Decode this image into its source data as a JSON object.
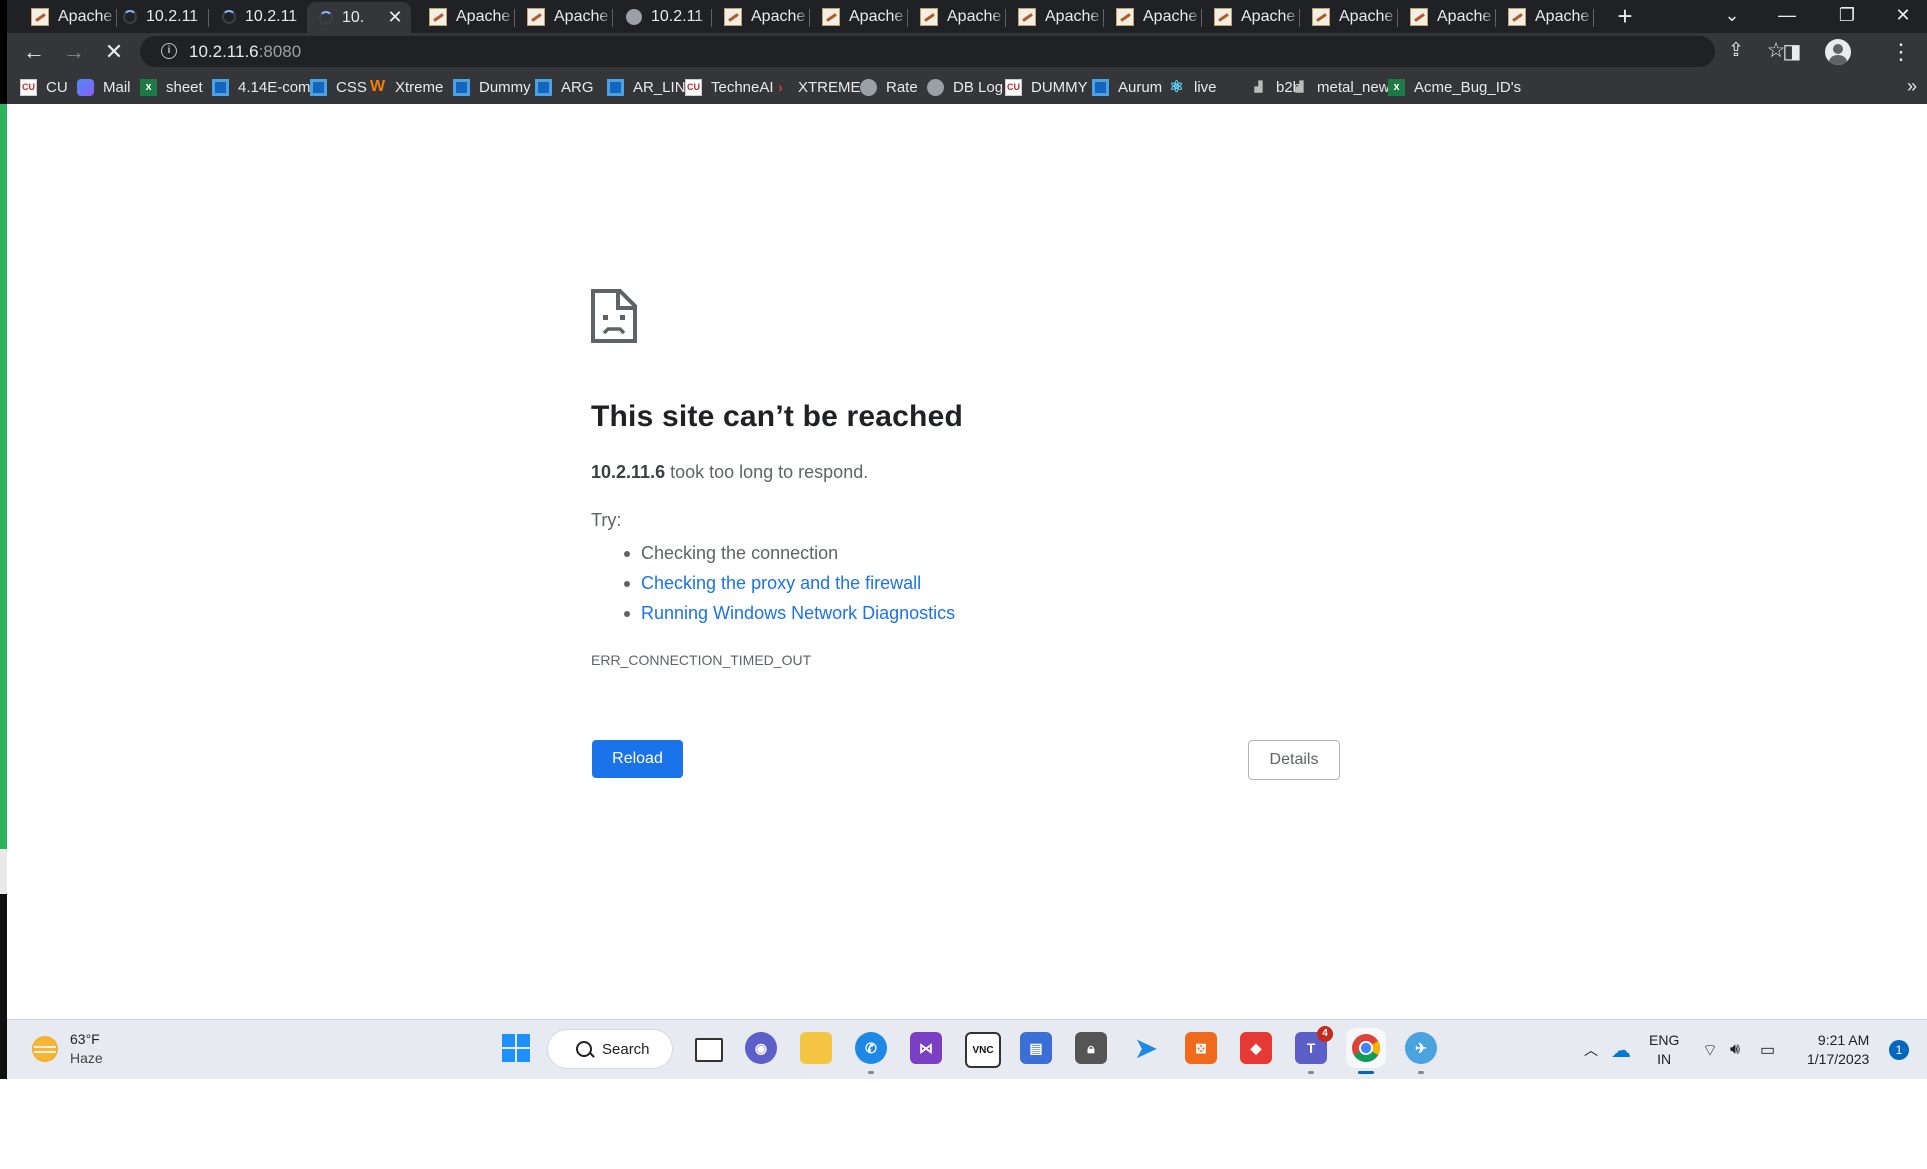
{
  "browser": {
    "tabs": [
      {
        "label": "Apache",
        "favicon": "apache-favicon"
      },
      {
        "label": "10.2.11",
        "favicon": "loading-spinner"
      },
      {
        "label": "10.2.11",
        "favicon": "loading-spinner"
      },
      {
        "label": "10.",
        "favicon": "loading-spinner",
        "active": true
      },
      {
        "label": "Apache",
        "favicon": "apache-favicon"
      },
      {
        "label": "Apache",
        "favicon": "apache-favicon"
      },
      {
        "label": "10.2.11",
        "favicon": "globe-favicon"
      },
      {
        "label": "Apache",
        "favicon": "apache-favicon"
      },
      {
        "label": "Apache",
        "favicon": "apache-favicon"
      },
      {
        "label": "Apache",
        "favicon": "apache-favicon"
      },
      {
        "label": "Apache",
        "favicon": "apache-favicon"
      },
      {
        "label": "Apache",
        "favicon": "apache-favicon"
      },
      {
        "label": "Apache",
        "favicon": "apache-favicon"
      },
      {
        "label": "Apache",
        "favicon": "apache-favicon"
      },
      {
        "label": "Apache",
        "favicon": "apache-favicon"
      },
      {
        "label": "Apache",
        "favicon": "apache-favicon"
      }
    ],
    "address": {
      "host": "10.2.11.6",
      "port": ":8080"
    },
    "bookmarks": [
      {
        "label": "CU",
        "icon": "cu"
      },
      {
        "label": "Mail",
        "icon": "mail"
      },
      {
        "label": "sheet",
        "icon": "xl"
      },
      {
        "label": "4.14E-com",
        "icon": "bl"
      },
      {
        "label": "CSS",
        "icon": "bl"
      },
      {
        "label": "Xtreme",
        "icon": "xt"
      },
      {
        "label": "Dummy",
        "icon": "bl"
      },
      {
        "label": "ARG",
        "icon": "bl"
      },
      {
        "label": "AR_LINK",
        "icon": "bl"
      },
      {
        "label": "TechneAI",
        "icon": "cu"
      },
      {
        "label": "XTREME",
        "icon": "arrow"
      },
      {
        "label": "Rate",
        "icon": "globe"
      },
      {
        "label": "DB Log",
        "icon": "globe"
      },
      {
        "label": "DUMMY",
        "icon": "cu"
      },
      {
        "label": "Aurum",
        "icon": "bl"
      },
      {
        "label": "live",
        "icon": "react"
      },
      {
        "label": "b2b",
        "icon": "mt"
      },
      {
        "label": "metal_new",
        "icon": "mt"
      },
      {
        "label": "Acme_Bug_ID's",
        "icon": "xl"
      }
    ],
    "more_bookmarks": "»"
  },
  "error_page": {
    "title": "This site can’t be reached",
    "host": "10.2.11.6",
    "description": " took too long to respond.",
    "try_label": "Try:",
    "suggestions": [
      {
        "text": "Checking the connection",
        "link": false
      },
      {
        "text": "Checking the proxy and the firewall",
        "link": true
      },
      {
        "text": "Running Windows Network Diagnostics",
        "link": true
      }
    ],
    "error_code": "ERR_CONNECTION_TIMED_OUT",
    "reload_label": "Reload",
    "details_label": "Details",
    "accent_color": "#1a73e8"
  },
  "taskbar": {
    "weather": {
      "temp": "63°F",
      "condition": "Haze"
    },
    "search_label": "Search",
    "teams_badge": "4",
    "language": {
      "line1": "ENG",
      "line2": "IN"
    },
    "clock": {
      "time": "9:21 AM",
      "date": "1/17/2023"
    },
    "notification_count": "1"
  }
}
